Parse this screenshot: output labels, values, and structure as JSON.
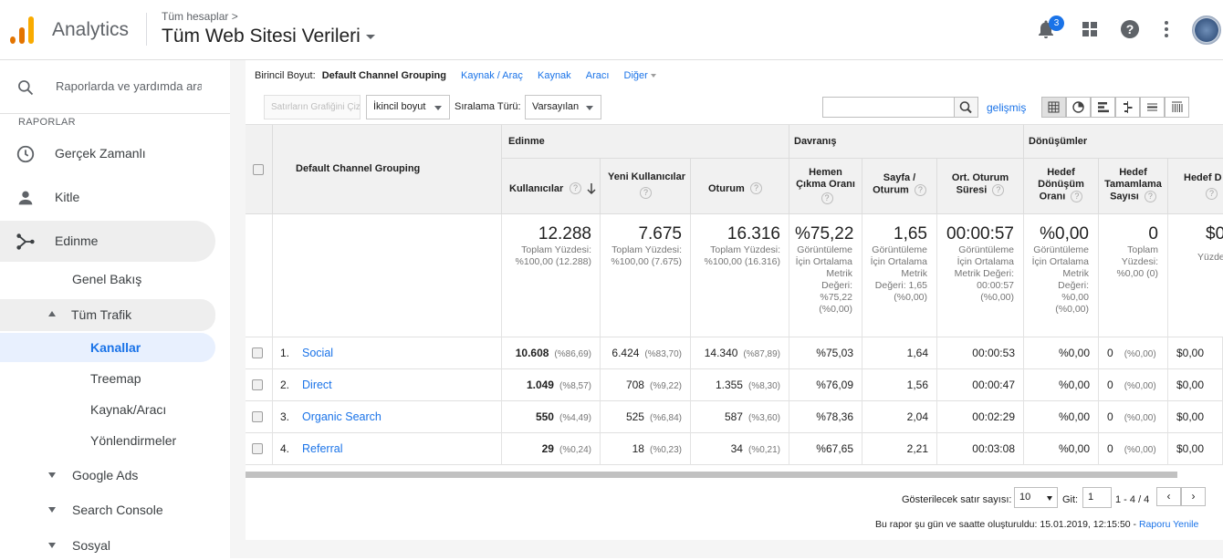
{
  "header": {
    "app_title": "Analytics",
    "breadcrumb": "Tüm hesaplar",
    "breadcrumb_sep": ">",
    "view_name": "Tüm Web Sitesi Verileri",
    "notif_count": "3",
    "colors": {
      "logo_dark": "#e37400",
      "logo_light": "#f9ab00",
      "accent": "#1a73e8"
    }
  },
  "sidebar": {
    "search_placeholder": "Raporlarda ve yardımda ara",
    "section_label": "RAPORLAR",
    "items": [
      {
        "label": "Gerçek Zamanlı",
        "icon": "clock-icon"
      },
      {
        "label": "Kitle",
        "icon": "person-icon"
      },
      {
        "label": "Edinme",
        "icon": "acquisition-icon"
      }
    ],
    "acq_sub": {
      "overview": "Genel Bakış",
      "all_traffic": "Tüm Trafik",
      "channels": "Kanallar",
      "treemap": "Treemap",
      "source_medium": "Kaynak/Aracı",
      "referrals": "Yönlendirmeler"
    },
    "collapsed": [
      "Google Ads",
      "Search Console",
      "Sosyal"
    ]
  },
  "report": {
    "primary_dim_label": "Birincil Boyut:",
    "primary_dim_current": "Default Channel Grouping",
    "dim_links": [
      "Kaynak / Araç",
      "Kaynak",
      "Aracı",
      "Diğer"
    ],
    "plot_rows_btn": "Satırların Grafiğini Çiz",
    "secondary_dim": "İkincil boyut",
    "sort_label": "Sıralama Türü:",
    "sort_value": "Varsayılan",
    "advanced": "gelişmiş"
  },
  "table": {
    "dim_header": "Default Channel Grouping",
    "groups": [
      "Edinme",
      "Davranış",
      "Dönüşümler"
    ],
    "columns": {
      "users": "Kullanıcılar",
      "new_users": "Yeni Kullanıcılar",
      "sessions": "Oturum",
      "bounce_l1": "Hemen",
      "bounce_l2": "Çıkma Oranı",
      "pps_l1": "Sayfa /",
      "pps_l2": "Oturum",
      "avg_l1": "Ort. Oturum",
      "avg_l2": "Süresi",
      "conv_l1": "Hedef",
      "conv_l2": "Dönüşüm",
      "conv_l3": "Oranı",
      "comp_l1": "Hedef",
      "comp_l2": "Tamamlama",
      "comp_l3": "Sayısı",
      "val_l1": "Hedef D"
    },
    "totals": {
      "users": "12.288",
      "users_sub": "Toplam Yüzdesi: %100,00 (12.288)",
      "new_users": "7.675",
      "new_users_sub": "Toplam Yüzdesi: %100,00 (7.675)",
      "sessions": "16.316",
      "sessions_sub": "Toplam Yüzdesi: %100,00 (16.316)",
      "bounce": "%75,22",
      "bounce_sub": "Görüntüleme İçin Ortalama Metrik Değeri: %75,22 (%0,00)",
      "pps": "1,65",
      "pps_sub": "Görüntüleme İçin Ortalama Metrik Değeri: 1,65 (%0,00)",
      "avg": "00:00:57",
      "avg_sub": "Görüntüleme İçin Ortalama Metrik Değeri: 00:00:57 (%0,00)",
      "conv": "%0,00",
      "conv_sub": "Görüntüleme İçin Ortalama Metrik Değeri: %0,00 (%0,00)",
      "comp": "0",
      "comp_sub": "Toplam Yüzdesi: %0,00 (0)",
      "val": "$0",
      "val_sub": "Yüzdesi"
    },
    "rows": [
      {
        "n": "1.",
        "name": "Social",
        "users": "10.608",
        "users_pct": "(%86,69)",
        "new": "6.424",
        "new_pct": "(%83,70)",
        "sess": "14.340",
        "sess_pct": "(%87,89)",
        "bounce": "%75,03",
        "pps": "1,64",
        "avg": "00:00:53",
        "conv": "%0,00",
        "comp": "0",
        "comp_pct": "(%0,00)",
        "val": "$0,00"
      },
      {
        "n": "2.",
        "name": "Direct",
        "users": "1.049",
        "users_pct": "(%8,57)",
        "new": "708",
        "new_pct": "(%9,22)",
        "sess": "1.355",
        "sess_pct": "(%8,30)",
        "bounce": "%76,09",
        "pps": "1,56",
        "avg": "00:00:47",
        "conv": "%0,00",
        "comp": "0",
        "comp_pct": "(%0,00)",
        "val": "$0,00"
      },
      {
        "n": "3.",
        "name": "Organic Search",
        "users": "550",
        "users_pct": "(%4,49)",
        "new": "525",
        "new_pct": "(%6,84)",
        "sess": "587",
        "sess_pct": "(%3,60)",
        "bounce": "%78,36",
        "pps": "2,04",
        "avg": "00:02:29",
        "conv": "%0,00",
        "comp": "0",
        "comp_pct": "(%0,00)",
        "val": "$0,00"
      },
      {
        "n": "4.",
        "name": "Referral",
        "users": "29",
        "users_pct": "(%0,24)",
        "new": "18",
        "new_pct": "(%0,23)",
        "sess": "34",
        "sess_pct": "(%0,21)",
        "bounce": "%67,65",
        "pps": "2,21",
        "avg": "00:03:08",
        "conv": "%0,00",
        "comp": "0",
        "comp_pct": "(%0,00)",
        "val": "$0,00"
      }
    ]
  },
  "footer": {
    "rows_label": "Gösterilecek satır sayısı:",
    "rows_value": "10",
    "goto_label": "Git:",
    "goto_value": "1",
    "range": "1 - 4 / 4",
    "prev": "‹",
    "next": "›",
    "generated": "Bu rapor şu gün ve saatte oluşturuldu: 15.01.2019, 12:15:50 -",
    "refresh": "Raporu Yenile"
  }
}
